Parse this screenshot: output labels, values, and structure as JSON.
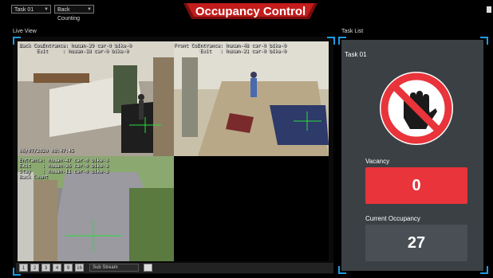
{
  "toolbar": {
    "task_select": "Task 01",
    "view_select": "Back Counting"
  },
  "header": {
    "title": "Occupancy Control"
  },
  "live_view": {
    "label": "Live View",
    "cam1": {
      "line1": "Back CouEntrance: human-29 car-0 bike-0",
      "line2": "      Exit     : human-18 car-0 bike-0",
      "timestamp": "06/07/2020 08:47:45"
    },
    "cam2": {
      "line1": "Front CoEntrance: human-48 car-0 bike-0",
      "line2": "         Exit   : human-21 car-0 bike-0"
    },
    "cam3": {
      "line1": "Entrance: human-47 car-0 bike-3",
      "line2": "Exit    : human-36 car-0 bike-3",
      "line3": "Stay    : human-11 car-0 bike-3",
      "line4": "Back Count"
    },
    "pages": [
      "1",
      "2",
      "3",
      "4",
      "9",
      "16"
    ],
    "stream": "Sub Stream"
  },
  "task_list": {
    "label": "Task List",
    "task_name": "Task 01",
    "vacancy_label": "Vacancy",
    "vacancy_value": "0",
    "occupancy_label": "Current Occupancy",
    "occupancy_value": "27",
    "colors": {
      "vacancy_bg": "#e8343a",
      "occupancy_bg": "#4a4f55",
      "panel_bg": "#3b4045",
      "accent": "#1e9be0",
      "title_red": "#c21c1c"
    },
    "icon": "no-entry-hand-icon"
  }
}
